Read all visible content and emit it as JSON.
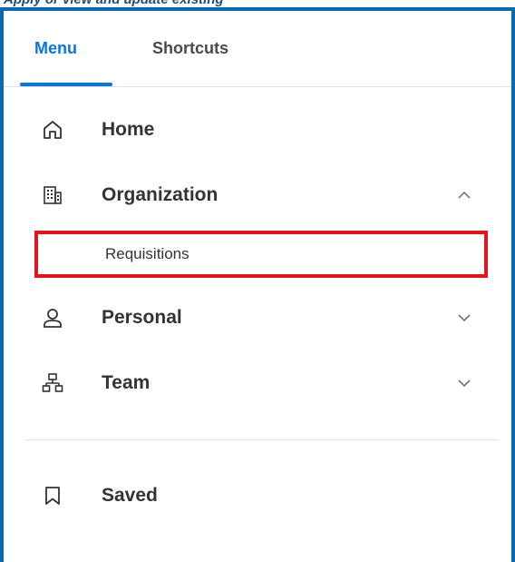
{
  "caption": "Apply or view and update existing",
  "tabs": [
    {
      "label": "Menu",
      "active": true
    },
    {
      "label": "Shortcuts",
      "active": false
    }
  ],
  "menu": {
    "home": {
      "label": "Home",
      "icon": "home-icon"
    },
    "organization": {
      "label": "Organization",
      "icon": "building-icon",
      "expanded": true
    },
    "requisitions": {
      "label": "Requisitions",
      "highlighted": true
    },
    "personal": {
      "label": "Personal",
      "icon": "person-icon",
      "expanded": false
    },
    "team": {
      "label": "Team",
      "icon": "org-chart-icon",
      "expanded": false
    },
    "saved": {
      "label": "Saved",
      "icon": "bookmark-icon"
    }
  },
  "colors": {
    "accent": "#0875e1",
    "frame": "#0a6ab0",
    "highlight_border": "#e0161f",
    "text": "#333333"
  }
}
